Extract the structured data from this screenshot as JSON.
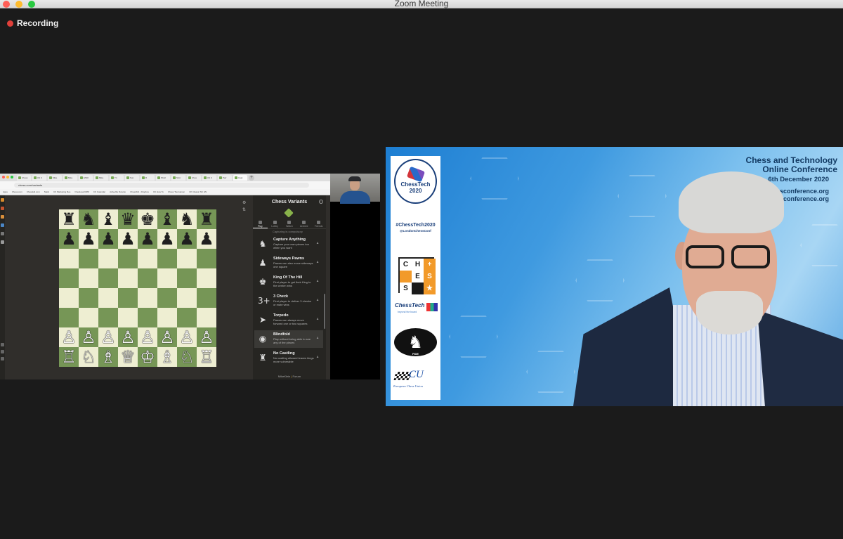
{
  "window": {
    "title": "Zoom Meeting"
  },
  "recording": {
    "label": "Recording",
    "color": "#e0403a"
  },
  "shared_screen": {
    "browser": {
      "tabs": [
        "Chess",
        "US C",
        "Mike",
        "Mike",
        "ENDI",
        "Mike",
        "Tri",
        "Sun",
        "R",
        "PAGI",
        "Shor",
        "Ches",
        "US C",
        "Pair",
        "Capt"
      ],
      "url": "chess.com/variants",
      "bookmarks": [
        "Apps",
        "Chess.com",
        "Chesskid.com",
        "Slack",
        "CK Marketing Res",
        "OneHope/CRM",
        "CK Calendar",
        "Asheville Downto",
        "ChessKid - Dropbox",
        "CK How To",
        "Chess Tournamen",
        "CK Classic NC HN"
      ]
    },
    "board": {
      "rows": [
        [
          "♜",
          "♞",
          "♝",
          "♛",
          "♚",
          "♝",
          "♞",
          "♜"
        ],
        [
          "♟",
          "♟",
          "♟",
          "♟",
          "♟",
          "♟",
          "♟",
          "♟"
        ],
        [
          "",
          "",
          "",
          "",
          "",
          "",
          "",
          ""
        ],
        [
          "",
          "",
          "",
          "",
          "",
          "",
          "",
          ""
        ],
        [
          "",
          "",
          "",
          "",
          "",
          "",
          "",
          ""
        ],
        [
          "",
          "",
          "",
          "",
          "",
          "",
          "",
          ""
        ],
        [
          "♙",
          "♙",
          "♙",
          "♙",
          "♙",
          "♙",
          "♙",
          "♙"
        ],
        [
          "♖",
          "♘",
          "♗",
          "♕",
          "♔",
          "♗",
          "♘",
          "♖"
        ]
      ],
      "light_color": "#eeeed2",
      "dark_color": "#769656"
    },
    "panel": {
      "title": "Chess Variants",
      "tabs": [
        "Play",
        "Lobby",
        "Watch",
        "Archive",
        "Friends"
      ],
      "truncated_line": "Capturing is compulsory",
      "variants": [
        {
          "name": "Capture Anything",
          "desc": "Capture your own pieces too when you want",
          "icon": "♞"
        },
        {
          "name": "Sideways Pawns",
          "desc": "Pawns can also move sideways one square",
          "icon": "♟"
        },
        {
          "name": "King Of The Hill",
          "desc": "First player to get their King to the center wins",
          "icon": "♚"
        },
        {
          "name": "3 Check",
          "desc": "First player to deliver 3 checks or mate wins",
          "icon": "3+"
        },
        {
          "name": "Torpedo",
          "desc": "Pawns can always move forward one or two squares",
          "icon": "➤"
        },
        {
          "name": "Blindfold",
          "desc": "Play without being able to see any of the pieces",
          "icon": "◉"
        },
        {
          "name": "No Castling",
          "desc": "No castling allowed leaves kings more vulnerable",
          "icon": "♜"
        }
      ],
      "footer_left": "MikeKlein",
      "footer_sep": "|",
      "footer_right": "Forum"
    }
  },
  "conference": {
    "title_line1": "Chess and Technology",
    "title_line2": "Online Conference",
    "date": "6th December 2020",
    "url1": "chessconference.org",
    "url2": "ssconference.org"
  },
  "sponsors": {
    "chesstech_name": "ChessTech",
    "chesstech_year": "2020",
    "hashtag": "#ChessTech2020",
    "handle": "@LondonChessConf",
    "chess_tiles": [
      "C",
      "H",
      "+",
      "",
      "E",
      "S",
      "S",
      "",
      "★"
    ],
    "chesstech_small": "ChessTech",
    "chesstech_small_sub": "beyond the board",
    "fide_label": "FIDE",
    "ecu_text": "CU",
    "ecu_sub": "European Chess Union"
  }
}
